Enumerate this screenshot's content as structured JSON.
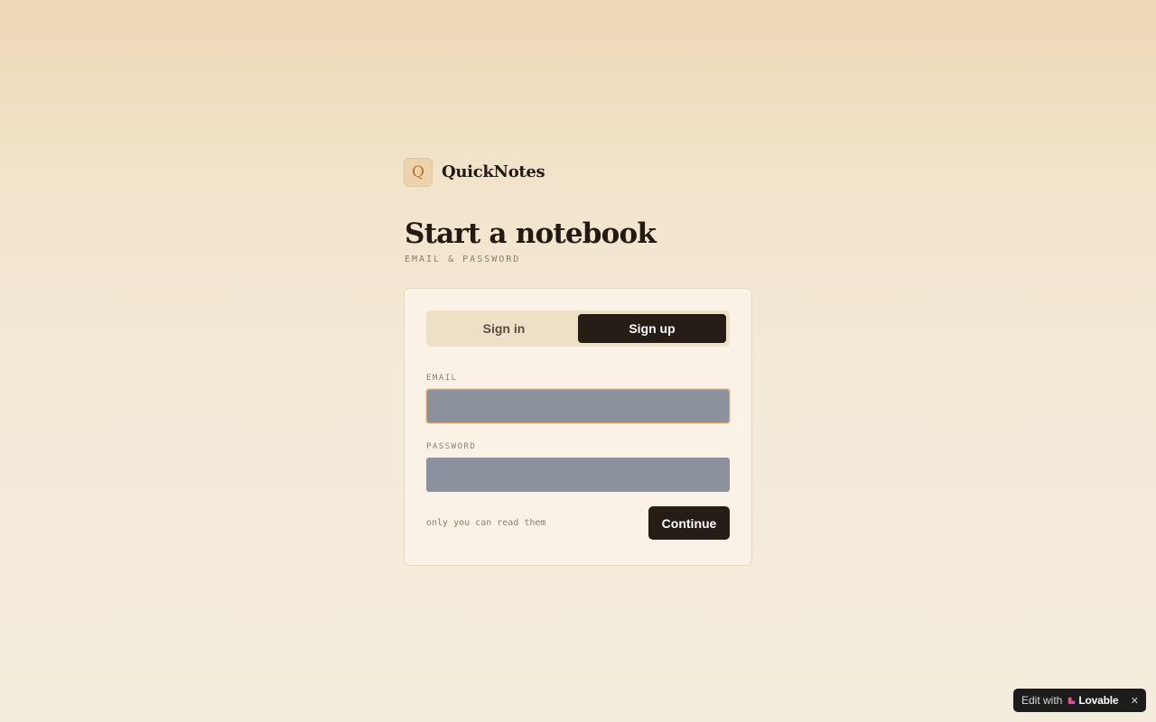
{
  "app": {
    "logo_letter": "Q",
    "name": "QuickNotes"
  },
  "header": {
    "title": "Start a notebook",
    "subtitle": "EMAIL & PASSWORD"
  },
  "auth": {
    "tabs": [
      {
        "label": "Sign in",
        "active": false
      },
      {
        "label": "Sign up",
        "active": true
      }
    ],
    "email": {
      "label": "EMAIL",
      "value": "",
      "placeholder": ""
    },
    "password": {
      "label": "PASSWORD",
      "value": "",
      "placeholder": ""
    },
    "hint": "only you can read them",
    "submit_label": "Continue"
  },
  "badge": {
    "prefix": "Edit with",
    "brand": "Lovable",
    "close_glyph": "✕",
    "icon": "lovable-heart-icon"
  },
  "colors": {
    "accent_dark": "#261d17",
    "logo_bg": "#ecd3ae",
    "logo_text": "#b86f2a",
    "input_fill": "#8b919d",
    "focus_ring": "#d0a46d"
  }
}
